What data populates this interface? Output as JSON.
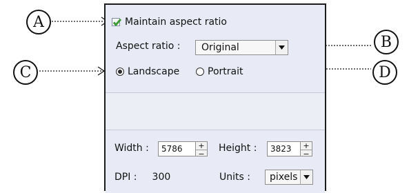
{
  "aspect": {
    "maintain_label": "Maintain aspect ratio",
    "maintain_checked": true,
    "ratio_label": "Aspect ratio :",
    "ratio_value": "Original"
  },
  "orientation": {
    "landscape_label": "Landscape",
    "portrait_label": "Portrait",
    "selected": "Landscape"
  },
  "size": {
    "width_label": "Width :",
    "width_value": "5786",
    "height_label": "Height :",
    "height_value": "3823",
    "spin_up": "+",
    "spin_down": "−",
    "dpi_label": "DPI :",
    "dpi_value": "300",
    "units_label": "Units :",
    "units_value": "pixels"
  },
  "callouts": {
    "a": "A",
    "b": "B",
    "c": "C",
    "d": "D"
  },
  "colors": {
    "panel_bg": "#eceef6",
    "check_green": "#3f9a3a"
  }
}
